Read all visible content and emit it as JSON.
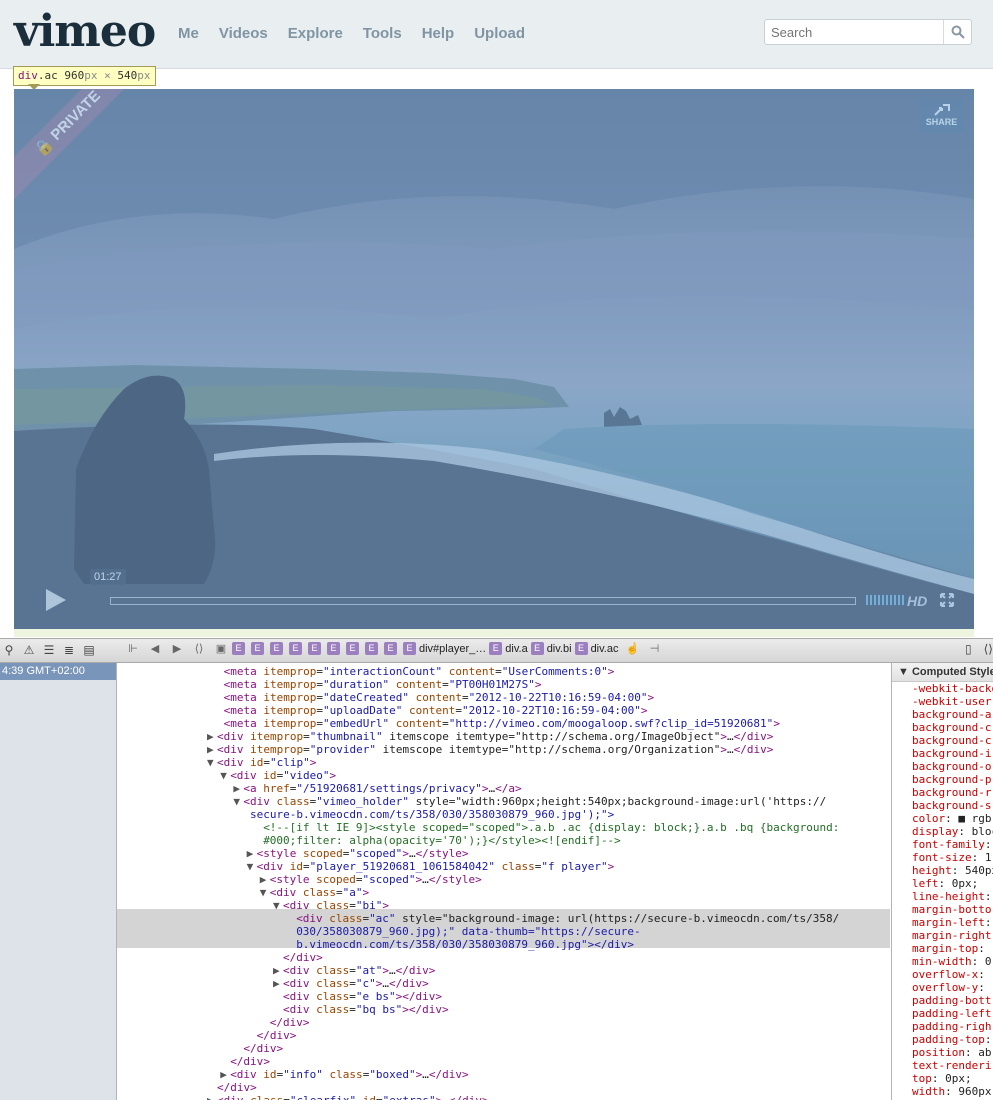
{
  "header": {
    "logo": "vimeo",
    "nav": [
      "Me",
      "Videos",
      "Explore",
      "Tools",
      "Help",
      "Upload"
    ],
    "search_placeholder": "Search"
  },
  "tooltip": {
    "tag": "div",
    "cls": ".ac",
    "w": "960",
    "h": "540",
    "unit": "px",
    "x": "×"
  },
  "player": {
    "ribbon": "PRIVATE",
    "share": "SHARE",
    "time": "01:27",
    "hd": "HD"
  },
  "devtools": {
    "breadcrumbs": [
      "div#player_…",
      "div.a",
      "div.bi",
      "div.ac"
    ],
    "left_time": "4:39 GMT+02:00",
    "computed_title": "Computed Style",
    "lines": [
      {
        "i": 7,
        "t": "n",
        "h": "<meta itemprop=\"interactionCount\" content=\"UserComments:0\">"
      },
      {
        "i": 7,
        "t": "n",
        "h": "<meta itemprop=\"duration\" content=\"PT00H01M27S\">"
      },
      {
        "i": 7,
        "t": "n",
        "h": "<meta itemprop=\"dateCreated\" content=\"2012-10-22T10:16:59-04:00\">"
      },
      {
        "i": 7,
        "t": "n",
        "h": "<meta itemprop=\"uploadDate\" content=\"2012-10-22T10:16:59-04:00\">"
      },
      {
        "i": 7,
        "t": "n",
        "h": "<meta itemprop=\"embedUrl\" content=\"http://vimeo.com/moogaloop.swf?clip_id=51920681\">"
      },
      {
        "i": 6,
        "t": "c",
        "h": "<div itemprop=\"thumbnail\" itemscope itemtype=\"http://schema.org/ImageObject\">…</div>"
      },
      {
        "i": 6,
        "t": "c",
        "h": "<div itemprop=\"provider\" itemscope itemtype=\"http://schema.org/Organization\">…</div>"
      },
      {
        "i": 6,
        "t": "o",
        "h": "<div id=\"clip\">"
      },
      {
        "i": 8,
        "t": "o",
        "h": "<div id=\"video\">"
      },
      {
        "i": 10,
        "t": "c",
        "h": "<a href=\"/51920681/settings/privacy\">…</a>"
      },
      {
        "i": 10,
        "t": "o",
        "h": "<div class=\"vimeo_holder\" style=\"width:960px;height:540px;background-image:url('https://"
      },
      {
        "i": 11,
        "t": "n",
        "raw": "secure-b.vimeocdn.com/ts/358/030/358030879_960.jpg');\">",
        "cls": "av"
      },
      {
        "i": 13,
        "t": "n",
        "raw": "<!--[if lt IE 9]><style scoped=\"scoped\">.a.b .ac {display: block;}.a.b .bq {background:",
        "cls": "cm"
      },
      {
        "i": 13,
        "t": "n",
        "raw": "#000;filter: alpha(opacity='70');}</style><![endif]-->",
        "cls": "cm"
      },
      {
        "i": 12,
        "t": "c",
        "h": "<style scoped=\"scoped\">…</style>"
      },
      {
        "i": 12,
        "t": "o",
        "h": "<div id=\"player_51920681_1061584042\" class=\"f player\">"
      },
      {
        "i": 14,
        "t": "c",
        "h": "<style scoped=\"scoped\">…</style>"
      },
      {
        "i": 14,
        "t": "o",
        "h": "<div class=\"a\">"
      },
      {
        "i": 16,
        "t": "o",
        "h": "<div class=\"bi\">"
      },
      {
        "i": 18,
        "t": "n",
        "sel": 1,
        "h": "<div class=\"ac\" style=\"background-image: url(https://secure-b.vimeocdn.com/ts/358/"
      },
      {
        "i": 18,
        "t": "n",
        "sel": 1,
        "raw": "030/358030879_960.jpg);\" data-thumb=\"https://secure-",
        "cls": "av"
      },
      {
        "i": 18,
        "t": "n",
        "sel": 1,
        "raw": "b.vimeocdn.com/ts/358/030/358030879_960.jpg\"></div>",
        "cls": "av"
      },
      {
        "i": 16,
        "t": "n",
        "h": "</div>"
      },
      {
        "i": 16,
        "t": "c",
        "h": "<div class=\"at\">…</div>"
      },
      {
        "i": 16,
        "t": "c",
        "h": "<div class=\"c\">…</div>"
      },
      {
        "i": 16,
        "t": "n",
        "h": "<div class=\"e bs\"></div>"
      },
      {
        "i": 16,
        "t": "n",
        "h": "<div class=\"bq bs\"></div>"
      },
      {
        "i": 14,
        "t": "n",
        "h": "</div>"
      },
      {
        "i": 12,
        "t": "n",
        "h": "</div>"
      },
      {
        "i": 10,
        "t": "n",
        "h": "</div>"
      },
      {
        "i": 8,
        "t": "n",
        "h": "</div>"
      },
      {
        "i": 8,
        "t": "c",
        "h": "<div id=\"info\" class=\"boxed\">…</div>"
      },
      {
        "i": 6,
        "t": "n",
        "h": "</div>"
      },
      {
        "i": 6,
        "t": "c",
        "h": "<div class=\"clearfix\" id=\"extras\">…</div>"
      }
    ],
    "computed": [
      [
        "-webkit-backg",
        ""
      ],
      [
        "-webkit-user",
        ""
      ],
      [
        "background-a",
        ""
      ],
      [
        "background-c",
        ""
      ],
      [
        "background-c",
        ""
      ],
      [
        "background-i",
        ""
      ],
      [
        "background-o",
        ""
      ],
      [
        "background-p",
        ""
      ],
      [
        "background-r",
        ""
      ],
      [
        "background-s",
        ""
      ],
      [
        "color",
        ": ■ rgb"
      ],
      [
        "display",
        ": block"
      ],
      [
        "font-family",
        ":"
      ],
      [
        "font-size",
        ": 1"
      ],
      [
        "height",
        ": 540px"
      ],
      [
        "left",
        ": 0px;"
      ],
      [
        "line-height",
        ":"
      ],
      [
        "margin-botto",
        ""
      ],
      [
        "margin-left",
        ":"
      ],
      [
        "margin-right",
        ""
      ],
      [
        "margin-top",
        ":"
      ],
      [
        "min-width",
        ": 0"
      ],
      [
        "overflow-x",
        ":"
      ],
      [
        "overflow-y",
        ":"
      ],
      [
        "padding-bott",
        ""
      ],
      [
        "padding-left",
        ""
      ],
      [
        "padding-righ",
        ""
      ],
      [
        "padding-top",
        ":"
      ],
      [
        "position",
        ": ab"
      ],
      [
        "text-renderi",
        ""
      ],
      [
        "top",
        ": 0px;"
      ],
      [
        "width",
        ": 960px"
      ]
    ]
  }
}
